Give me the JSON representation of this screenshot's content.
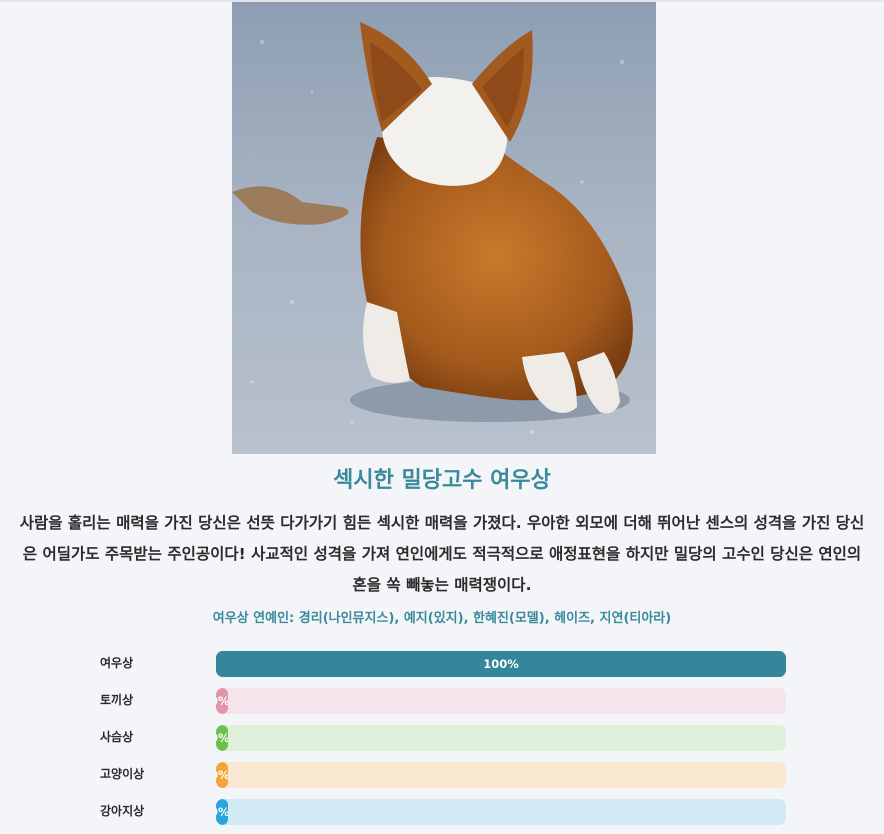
{
  "result": {
    "title": "섹시한 밀당고수 여우상",
    "description": "사람을 홀리는 매력을 가진 당신은 선뜻 다가가기 힘든 섹시한 매력을 가졌다. 우아한 외모에 더해 뛰어난 센스의 성격을 가진 당신은 어딜가도 주목받는 주인공이다! 사교적인 성격을 가져 연인에게도 적극적으로 애정표현을 하지만 밀당의 고수인 당신은 연인의 혼을 쏙 빼놓는 매력쟁이다.",
    "celebrities": "여우상 연예인: 경리(나인뮤지스), 예지(있지), 한혜진(모델), 헤이즈, 지연(티아라)"
  },
  "bars": [
    {
      "label": "여우상",
      "percent_text": "100%",
      "value": 100,
      "fill": "#34869b",
      "track": "#34869b"
    },
    {
      "label": "토끼상",
      "percent_text": "0%",
      "value": 0,
      "fill": "#e493ab",
      "track": "#f6e4ec"
    },
    {
      "label": "사슴상",
      "percent_text": "0%",
      "value": 0,
      "fill": "#6cc24f",
      "track": "#dff1da"
    },
    {
      "label": "고양이상",
      "percent_text": "0%",
      "value": 0,
      "fill": "#f2a63a",
      "track": "#fbe8d2"
    },
    {
      "label": "강아지상",
      "percent_text": "0%",
      "value": 0,
      "fill": "#26a6da",
      "track": "#d2e9f6"
    }
  ]
}
